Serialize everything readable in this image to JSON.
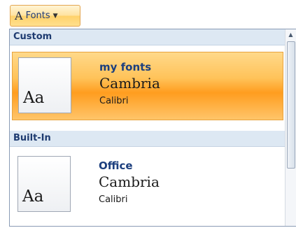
{
  "ribbon": {
    "fonts_button": {
      "icon_glyph": "A",
      "label": "Fonts",
      "dropdown_icon": "chevron-down-icon"
    }
  },
  "gallery": {
    "sections": [
      {
        "header": "Custom",
        "items": [
          {
            "theme_name": "my fonts",
            "heading_font": "Cambria",
            "body_font": "Calibri",
            "preview": "Aa",
            "selected": true
          }
        ]
      },
      {
        "header": "Built-In",
        "items": [
          {
            "theme_name": "Office",
            "heading_font": "Cambria",
            "body_font": "Calibri",
            "preview": "Aa",
            "selected": false
          }
        ]
      }
    ],
    "scrollbar": {
      "up_icon": "scroll-up-arrow-icon"
    }
  },
  "colors": {
    "selection_orange": "#ff9d1f",
    "header_bg": "#dde8f3",
    "theme_name_blue": "#1c3f7e"
  }
}
